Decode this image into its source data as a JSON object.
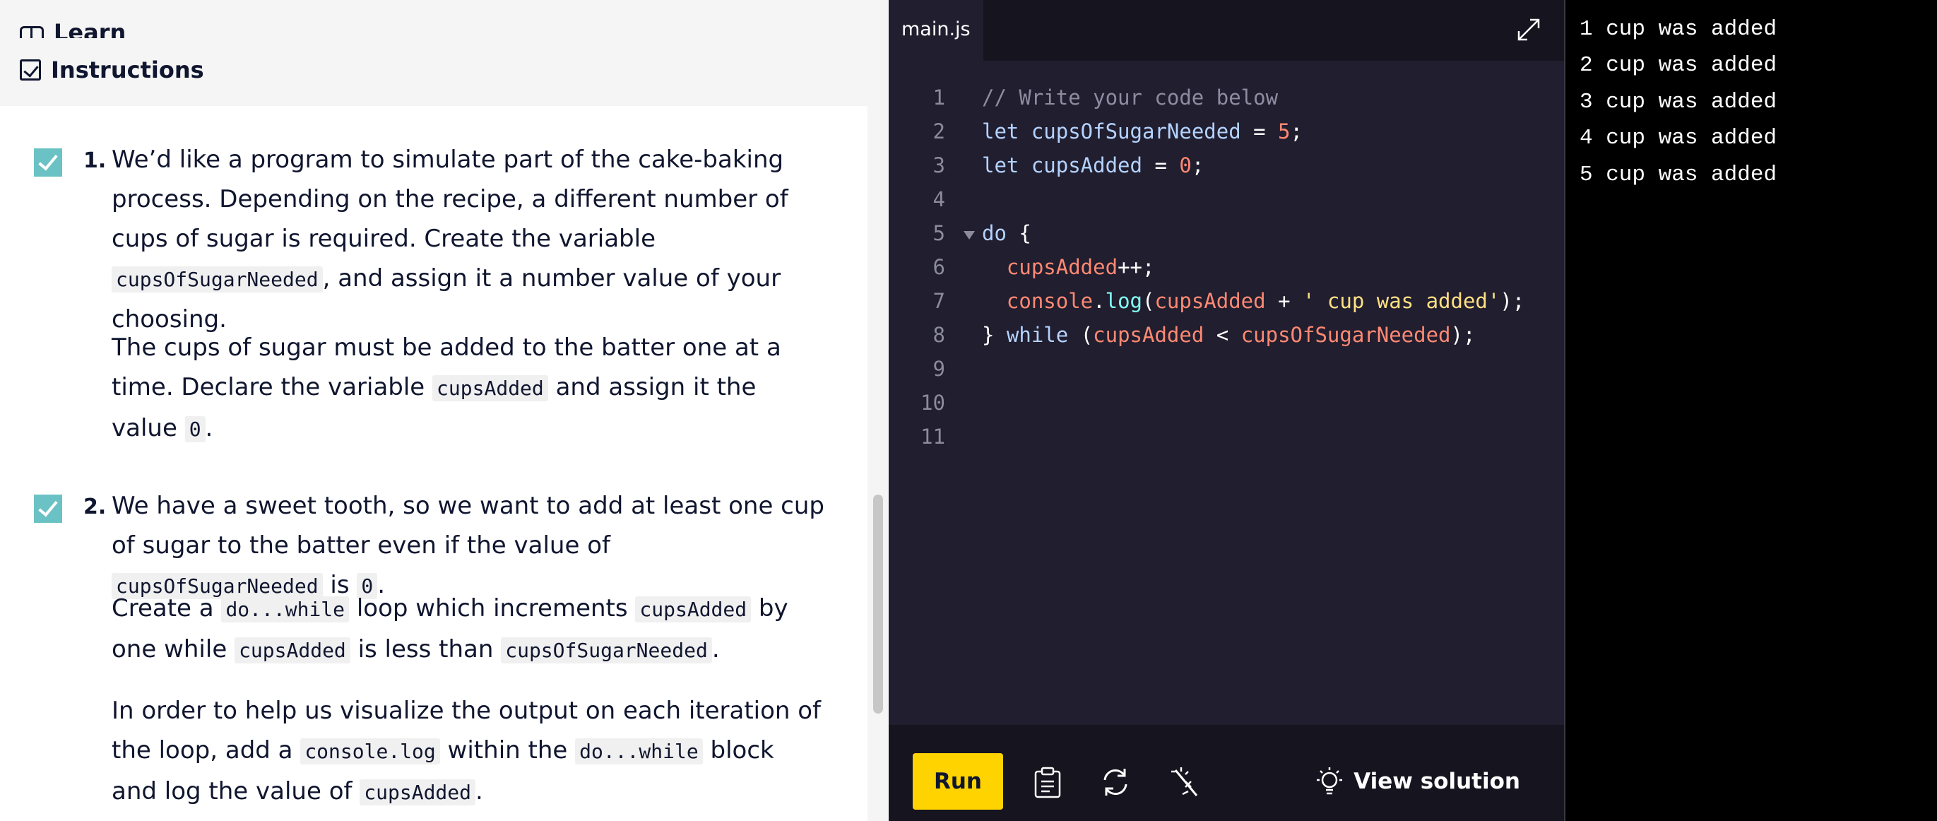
{
  "left_panel": {
    "learn_label": "Learn",
    "instructions_label": "Instructions",
    "tasks": [
      {
        "number": "1.",
        "p1": [
          "We’d like a program to simulate part of the cake-baking process. Depending on the recipe, a different number of cups of sugar is required. Create the variable ",
          "cupsOfSugarNeeded",
          ", and assign it a number value of your choosing."
        ],
        "p2": [
          "The cups of sugar must be added to the batter one at a time. Declare the variable ",
          "cupsAdded",
          " and assign it the value ",
          "0",
          "."
        ]
      },
      {
        "number": "2.",
        "p1": [
          "We have a sweet tooth, so we want to add at least one cup of sugar to the batter even if the value of ",
          "cupsOfSugarNeeded",
          " is ",
          "0",
          "."
        ],
        "p2": [
          "Create a ",
          "do...while",
          " loop which increments ",
          "cupsAdded",
          " by one while ",
          "cupsAdded",
          " is less than ",
          "cupsOfSugarNeeded",
          "."
        ],
        "p3": [
          "In order to help us visualize the output on each iteration of the loop, add a ",
          "console.log",
          " within the ",
          "do...while",
          " block and log the value of ",
          "cupsAdded",
          "."
        ]
      }
    ]
  },
  "editor": {
    "tab_label": "main.js",
    "line_numbers": [
      "1",
      "2",
      "3",
      "4",
      "5",
      "6",
      "7",
      "8",
      "9",
      "10",
      "11"
    ],
    "code": {
      "l1": "// Write your code below",
      "l2_kw": "let ",
      "l2_var": "cupsOfSugarNeeded",
      "l2_eq": " = ",
      "l2_num": "5",
      "l2_end": ";",
      "l3_kw": "let ",
      "l3_var": "cupsAdded",
      "l3_eq": " = ",
      "l3_num": "0",
      "l3_end": ";",
      "l5_kw": "do",
      "l5_rest": " {",
      "l6_var": "cupsAdded",
      "l6_rest": "++;",
      "l7_obj": "console",
      "l7_dot": ".",
      "l7_fn": "log",
      "l7_p1": "(",
      "l7_var": "cupsAdded",
      "l7_plus": " + ",
      "l7_str": "' cup was added'",
      "l7_end": ");",
      "l8_a": "} ",
      "l8_kw": "while",
      "l8_p": " (",
      "l8_var1": "cupsAdded",
      "l8_op": " < ",
      "l8_var2": "cupsOfSugarNeeded",
      "l8_end": ");"
    },
    "toolbar": {
      "run_label": "Run",
      "view_solution_label": "View solution"
    }
  },
  "output": {
    "lines": [
      "1 cup was added",
      "2 cup was added",
      "3 cup was added",
      "4 cup was added",
      "5 cup was added"
    ]
  }
}
